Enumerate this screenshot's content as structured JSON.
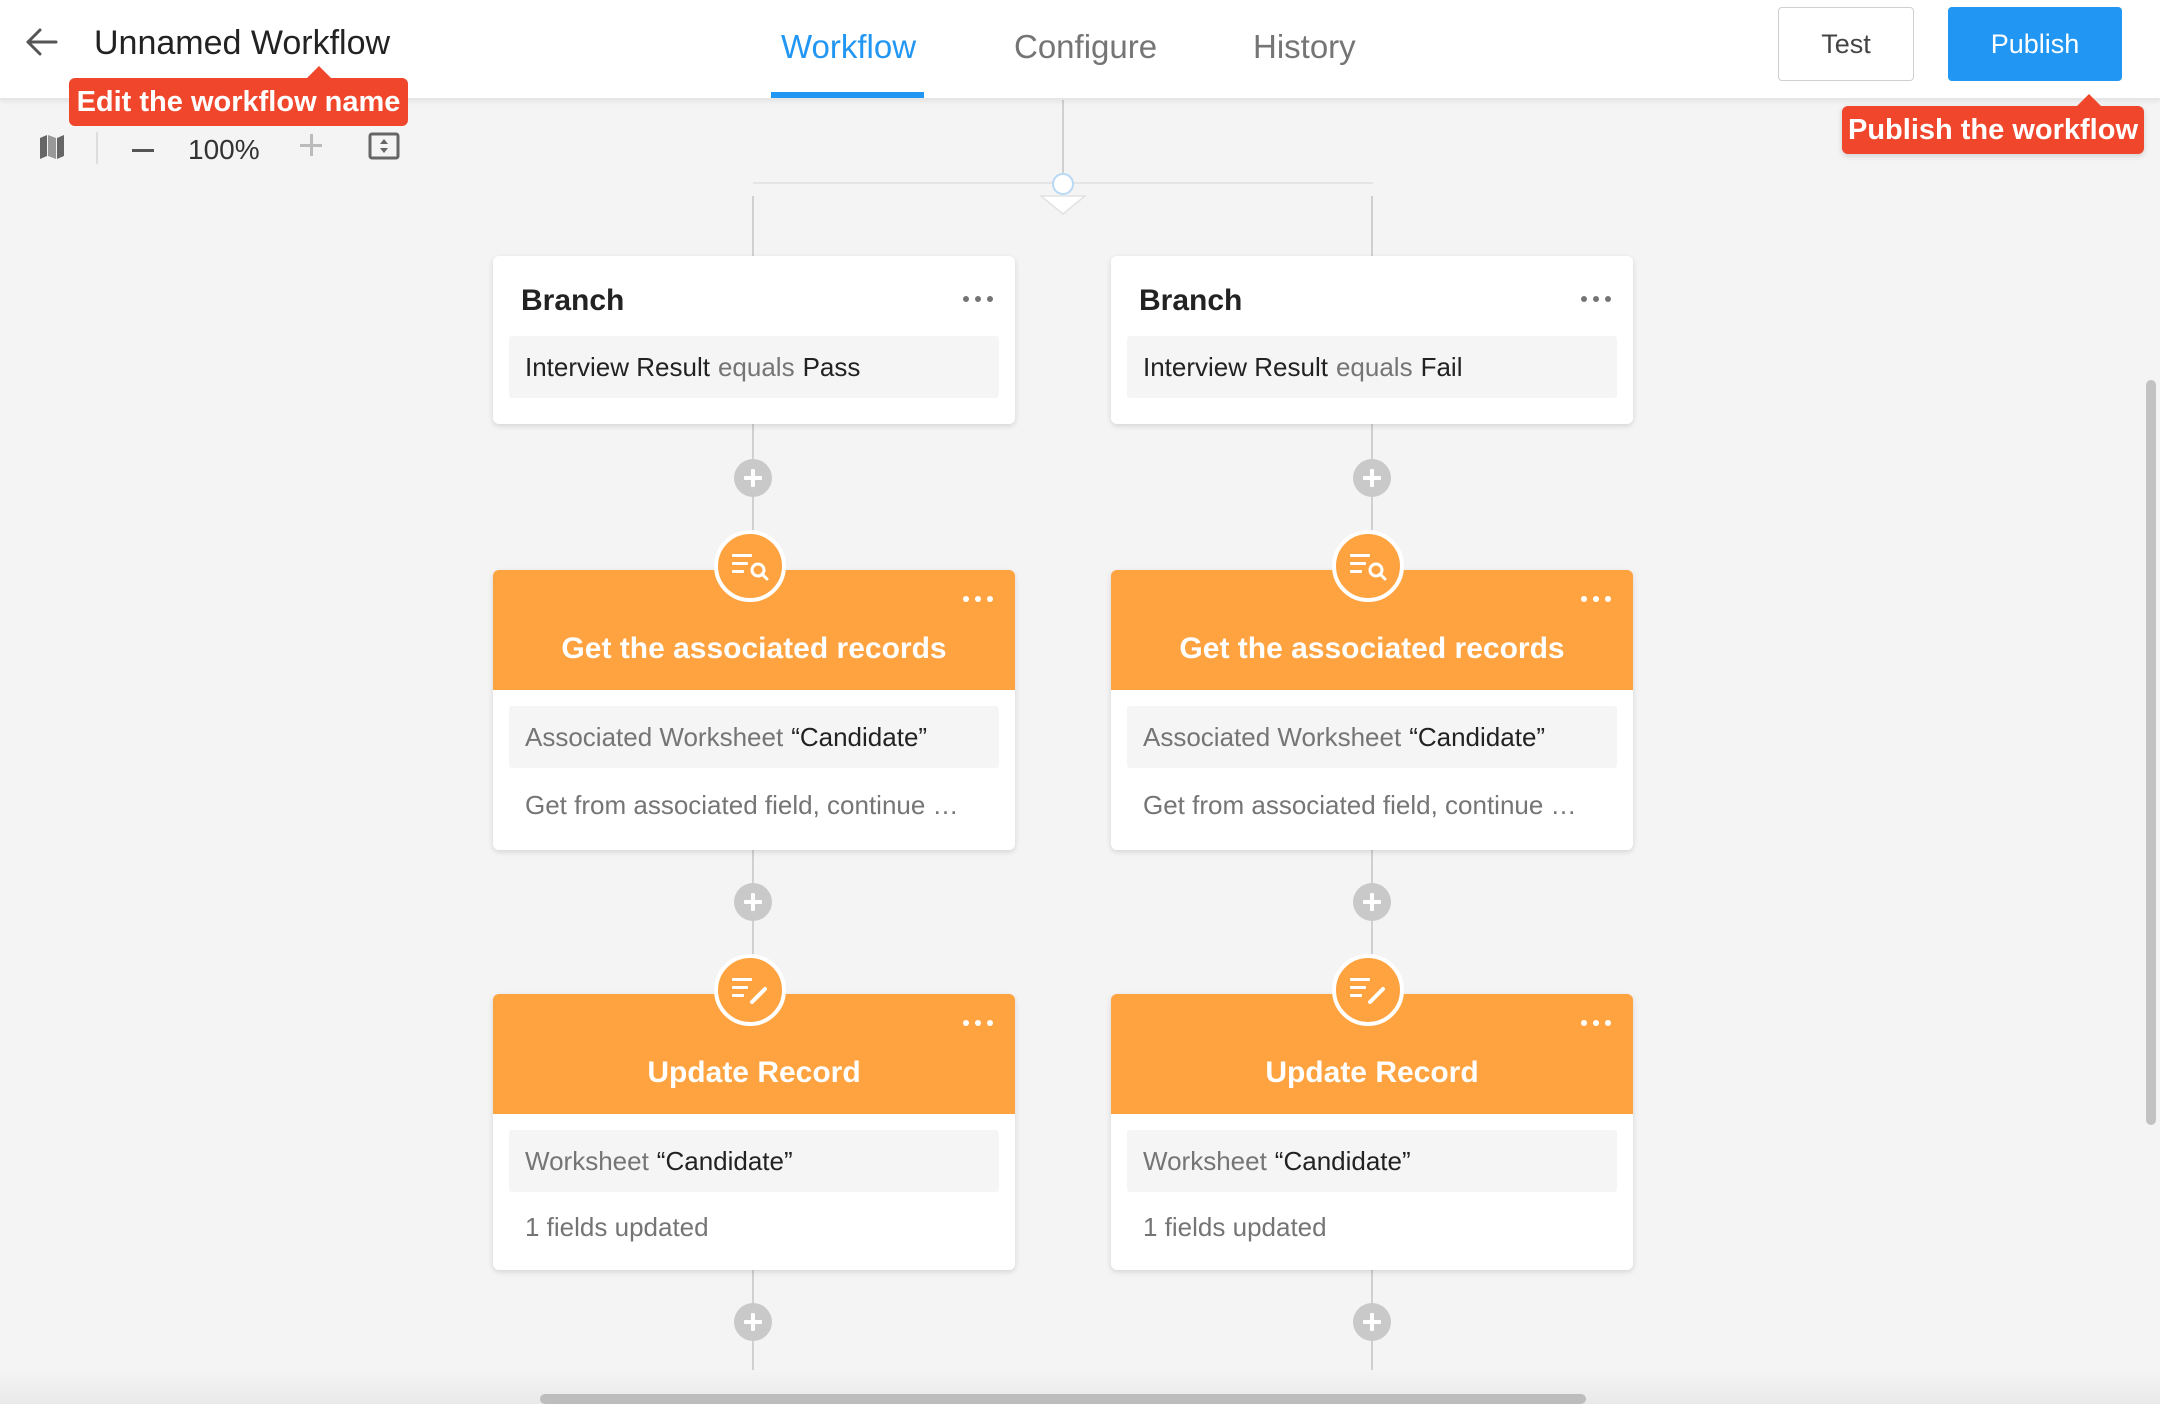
{
  "header": {
    "title": "Unnamed Workflow",
    "tabs": [
      {
        "label": "Workflow",
        "active": true
      },
      {
        "label": "Configure",
        "active": false
      },
      {
        "label": "History",
        "active": false
      }
    ],
    "test_label": "Test",
    "publish_label": "Publish"
  },
  "callouts": {
    "edit_name": "Edit the workflow name",
    "publish": "Publish the workflow"
  },
  "toolbar": {
    "zoom_level": "100%"
  },
  "colors": {
    "accent": "#2196f3",
    "node_orange": "#ffa340",
    "callout_red": "#f0462c"
  },
  "branches": [
    {
      "branch": {
        "title": "Branch",
        "field": "Interview Result",
        "operator": "equals",
        "value": "Pass"
      },
      "get_records": {
        "title": "Get the associated records",
        "worksheet_label": "Associated Worksheet",
        "worksheet_value": "“Candidate”",
        "description": "Get from associated field, continue …"
      },
      "update": {
        "title": "Update Record",
        "worksheet_label": "Worksheet",
        "worksheet_value": "“Candidate”",
        "description": "1 fields updated"
      }
    },
    {
      "branch": {
        "title": "Branch",
        "field": "Interview Result",
        "operator": "equals",
        "value": "Fail"
      },
      "get_records": {
        "title": "Get the associated records",
        "worksheet_label": "Associated Worksheet",
        "worksheet_value": "“Candidate”",
        "description": "Get from associated field, continue …"
      },
      "update": {
        "title": "Update Record",
        "worksheet_label": "Worksheet",
        "worksheet_value": "“Candidate”",
        "description": "1 fields updated"
      }
    }
  ]
}
